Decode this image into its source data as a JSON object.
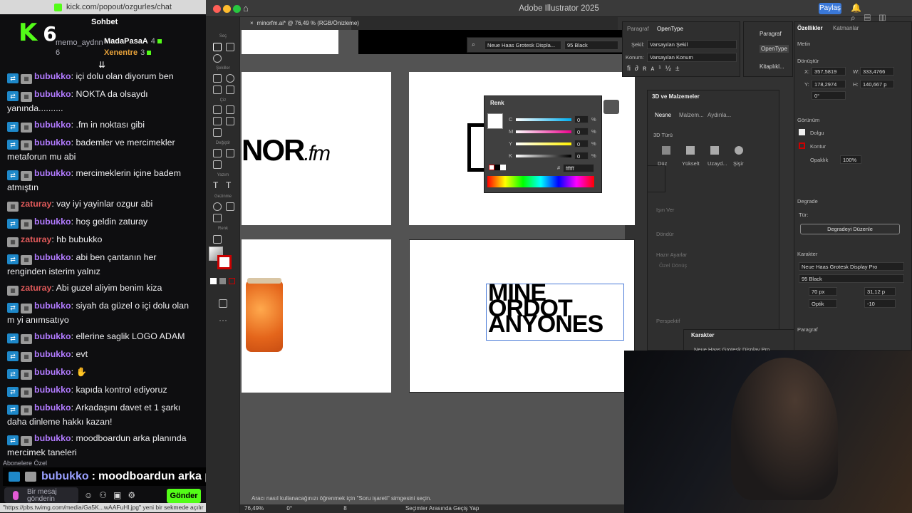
{
  "chat": {
    "url": "kick.com/popout/ozgurles/chat",
    "logo_letter": "K",
    "logo_num": "6",
    "title": "Sohbet",
    "top": [
      {
        "name": "memo_aydnn",
        "count": "6"
      },
      {
        "name": "MadaPasaA",
        "count": "4"
      },
      {
        "name": "Xenentre",
        "count": "3"
      }
    ],
    "messages": [
      {
        "user": "bubukko",
        "color": "purple",
        "text": "içi dolu olan diyorum ben",
        "b1": true
      },
      {
        "user": "bubukko",
        "color": "purple",
        "text": "NOKTA da olsaydı yanında..........",
        "b1": true
      },
      {
        "user": "bubukko",
        "color": "purple",
        "text": ".fm in noktası gibi",
        "b1": true
      },
      {
        "user": "bubukko",
        "color": "purple",
        "text": "bademler ve mercimekler metaforun mu abi",
        "b1": true
      },
      {
        "user": "bubukko",
        "color": "purple",
        "text": "mercimeklerin içine badem atmıştın",
        "b1": true
      },
      {
        "user": "zaturay",
        "color": "red",
        "text": "vay iyi yayinlar ozgur abi",
        "b1": false
      },
      {
        "user": "bubukko",
        "color": "purple",
        "text": "hoş geldin zaturay",
        "b1": true
      },
      {
        "user": "zaturay",
        "color": "red",
        "text": "hb bubukko",
        "b1": false
      },
      {
        "user": "bubukko",
        "color": "purple",
        "text": "abi ben çantanın her renginden isterim yalnız",
        "b1": true
      },
      {
        "user": "zaturay",
        "color": "red",
        "text": "Abi guzel aliyim benim kiza",
        "b1": false
      },
      {
        "user": "bubukko",
        "color": "purple",
        "text": "siyah da güzel o içi dolu olan m yi anımsatıyo",
        "b1": true
      },
      {
        "user": "bubukko",
        "color": "purple",
        "text": "ellerine saglik LOGO ADAM",
        "b1": true
      },
      {
        "user": "bubukko",
        "color": "purple",
        "text": "evt",
        "b1": true
      },
      {
        "user": "bubukko",
        "color": "purple",
        "text": "✋",
        "b1": true
      },
      {
        "user": "bubukko",
        "color": "purple",
        "text": "kapıda kontrol ediyoruz",
        "b1": true
      },
      {
        "user": "bubukko",
        "color": "purple",
        "text": "Arkadaşını davet et 1 şarkı daha dinleme hakkı kazan!",
        "b1": true
      },
      {
        "user": "bubukko",
        "color": "purple",
        "text": "moodboardun arka planında mercimek taneleri",
        "b1": true
      }
    ],
    "subscribers_label": "Abonelere Özel",
    "overlay_user": "bubukko",
    "overlay_text": "moodboardun arka planında mercimek taneleri",
    "input_placeholder": "Bir mesaj gönderin",
    "send_label": "Gönder",
    "status_url": "\"https://pbs.twimg.com/media/Ga5K...wAAFuHl.jpg\" yeni bir sekmede açılır"
  },
  "ai": {
    "window_title": "Adobe Illustrator 2025",
    "share_label": "Paylaş",
    "doc_tab": "minorfm.ai* @ 76,49 % (RGB/Önizleme)",
    "font_name": "Neue Haas Grotesk Displa...",
    "font_style": "95 Black",
    "toolbar_labels": [
      "Seç",
      "Şekiller",
      "Çiz",
      "Değiştir",
      "Yazım",
      "Gezinme",
      "Renk"
    ],
    "artboard_logo": "NOR",
    "artboard_logo_fm": ".fm",
    "art_text_1": "MINE",
    "art_text_2": "ORDOT",
    "art_text_3": "ANYONES",
    "renk": {
      "title": "Renk",
      "labels": [
        "C",
        "M",
        "Y",
        "K"
      ],
      "values": [
        "0",
        "0",
        "0",
        "0"
      ],
      "pct": "%",
      "hex": "ffffff",
      "hash": "#"
    },
    "paragraf": {
      "tab1": "Paragraf",
      "tab2": "OpenType",
      "sekil_label": "Şekil:",
      "sekil_value": "Varsayılan Şekil",
      "konum_label": "Konum:",
      "konum_value": "Varsayılan Konum"
    },
    "dock": [
      "Paragraf",
      "OpenType",
      "Kitaplıkl..."
    ],
    "threed": {
      "title": "3D ve Malzemeler",
      "tabs": [
        "Nesne",
        "Malzem...",
        "Aydınla..."
      ],
      "type_label": "3D Türü",
      "types": [
        "Düz",
        "Yükselt",
        "Uzayd...",
        "Şişir"
      ],
      "light": "Işın Ver",
      "rotate": "Döndür",
      "preset_label": "Hazır Ayarlar",
      "preset_value": "Özel Dönüş",
      "persp": "Perspektif"
    },
    "karakter_float": {
      "title": "Karakter",
      "font": "Neue Haas Grotesk Display Pro"
    },
    "props": {
      "tab1": "Özellikler",
      "tab2": "Katmanlar",
      "metin": "Metin",
      "donustur": "Dönüştür",
      "x": "357,5819",
      "y": "178,2974",
      "w": "333,4766",
      "h": "140,667 p",
      "angle": "0°",
      "gorunum": "Görünüm",
      "dolgu": "Dolgu",
      "kontur": "Kontur",
      "opaklik": "Opaklık",
      "opaklik_val": "100%",
      "degrade": "Degrade",
      "tur": "Tür:",
      "degrade_btn": "Degradeyi Düzenle",
      "karakter": "Karakter",
      "font": "Neue Haas Grotesk Display Pro",
      "style": "95 Black",
      "size": "70 px",
      "leading": "31,12 p",
      "kerning": "Optik",
      "tracking": "-10",
      "paragraf": "Paragraf"
    },
    "hint": "Aracı nasıl kullanacağınızı öğrenmek için \"Soru işareti\" simgesini seçin.",
    "zoom": "76,49%",
    "angle": "0°",
    "page": "8",
    "status_mode": "Seçimler Arasında Geçiş Yap"
  }
}
